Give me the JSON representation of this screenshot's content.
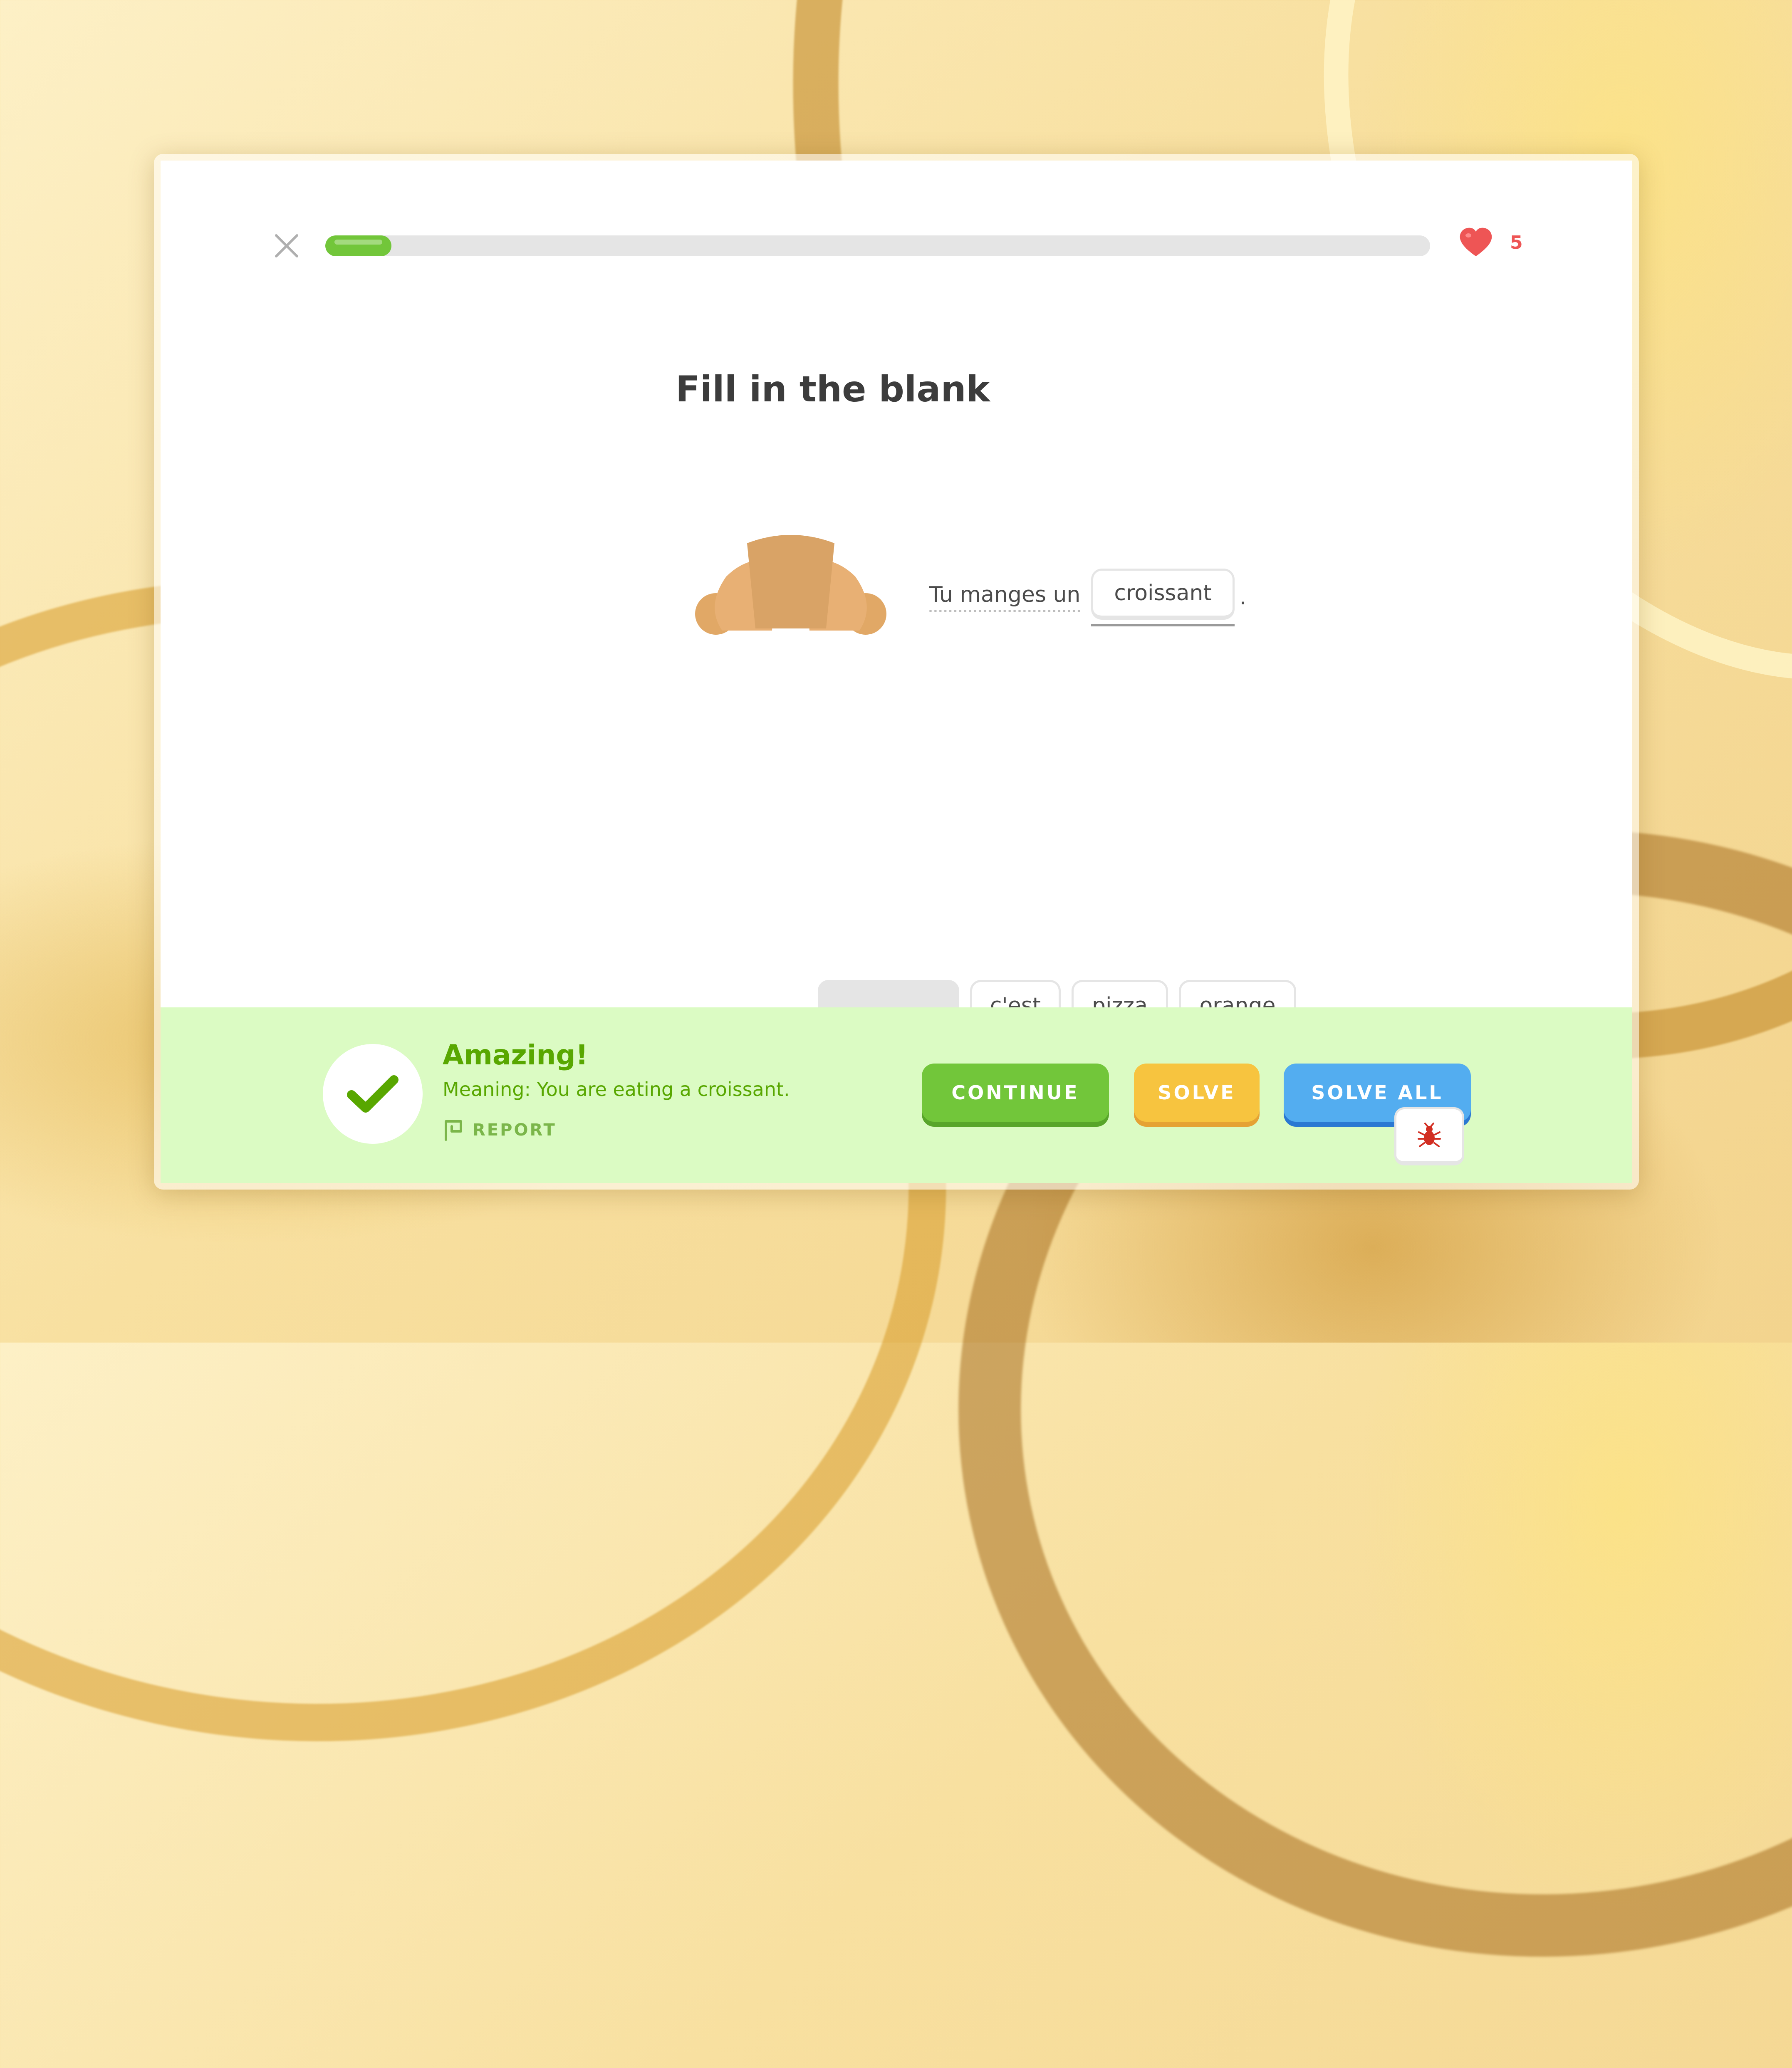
{
  "colors": {
    "accent_green": "#72c63a",
    "heart_red": "#ee5555",
    "feedback_bg": "#dbfbc3",
    "feedback_text": "#58a700",
    "solve_yellow": "#f7c43f",
    "solve_all_blue": "#53adf0"
  },
  "header": {
    "close_icon": "close-icon",
    "progress": 0.06,
    "hearts": {
      "icon": "heart-icon",
      "count": "5"
    }
  },
  "challenge": {
    "title": "Fill in the blank",
    "image_icon": "croissant-icon",
    "sentence_prefix": "Tu manges un",
    "answer": "croissant",
    "sentence_suffix": "."
  },
  "word_bank": {
    "options": [
      "c'est",
      "pizza",
      "orange"
    ]
  },
  "feedback": {
    "title": "Amazing!",
    "meaning": "Meaning: You are eating a croissant.",
    "report_label": "REPORT"
  },
  "actions": {
    "continue": "CONTINUE",
    "solve": "SOLVE",
    "solve_all": "SOLVE ALL",
    "debug_icon": "bug-icon"
  }
}
